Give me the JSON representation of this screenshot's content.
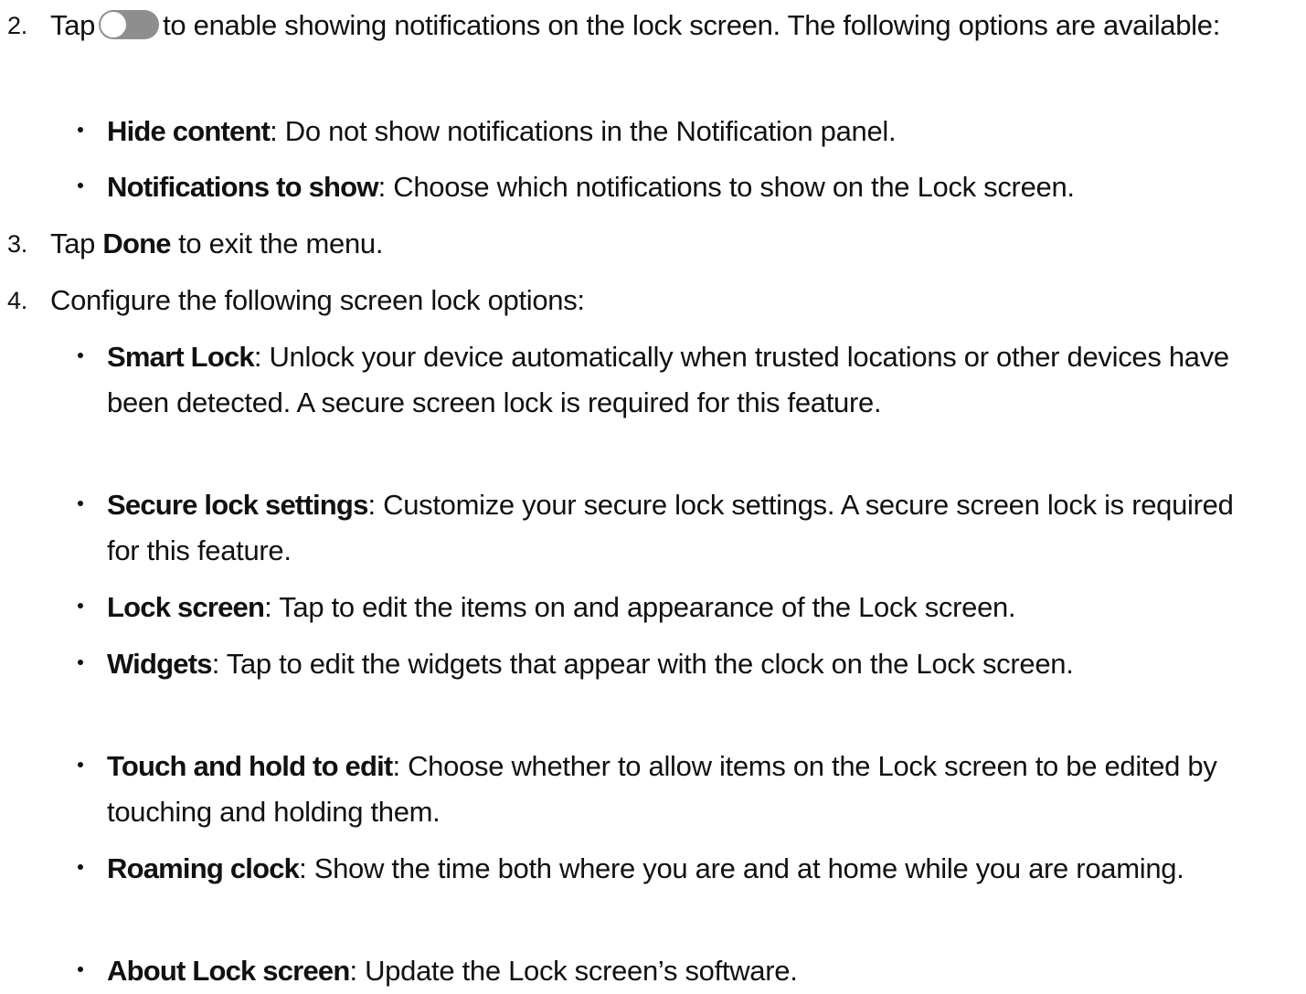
{
  "steps": [
    {
      "number": "2.",
      "text_before": "Tap",
      "toggle_icon": "toggle-off-icon",
      "text_after": "to enable showing notifications on the lock screen. The following options are available:",
      "bullets": [
        {
          "term": "Hide content",
          "description": ": Do not show notifications in the Notification panel."
        },
        {
          "term": "Notifications to show",
          "description": ": Choose which notifications to show on the Lock screen."
        }
      ]
    },
    {
      "number": "3.",
      "text_before": "Tap",
      "term": "Done",
      "text_after": "to exit the menu."
    },
    {
      "number": "4.",
      "text": "Configure the following screen lock options:",
      "bullets": [
        {
          "term": "Smart Lock",
          "description": ": Unlock your device automatically when trusted locations or other devices have been detected. A secure screen lock is required for this feature."
        },
        {
          "term": "Secure lock settings",
          "description": ": Customize your secure lock settings. A secure screen lock is required for this feature."
        },
        {
          "term": "Lock screen",
          "description": ": Tap to edit the items on and appearance of the Lock screen."
        },
        {
          "term": "Widgets",
          "description": ": Tap to edit the widgets that appear with the clock on the Lock screen."
        },
        {
          "term": "Touch and hold to edit",
          "description": ": Choose whether to allow items on the Lock screen to be edited by touching and holding them."
        },
        {
          "term": "Roaming clock",
          "description": ": Show the time both where you are and at home while you are roaming."
        },
        {
          "term": "About Lock screen",
          "description": ": Update the Lock screen’s software."
        }
      ]
    }
  ],
  "colors": {
    "text": "#111111",
    "toggle_track": "#8e8e8e",
    "toggle_knob": "#ffffff",
    "background": "#ffffff"
  }
}
